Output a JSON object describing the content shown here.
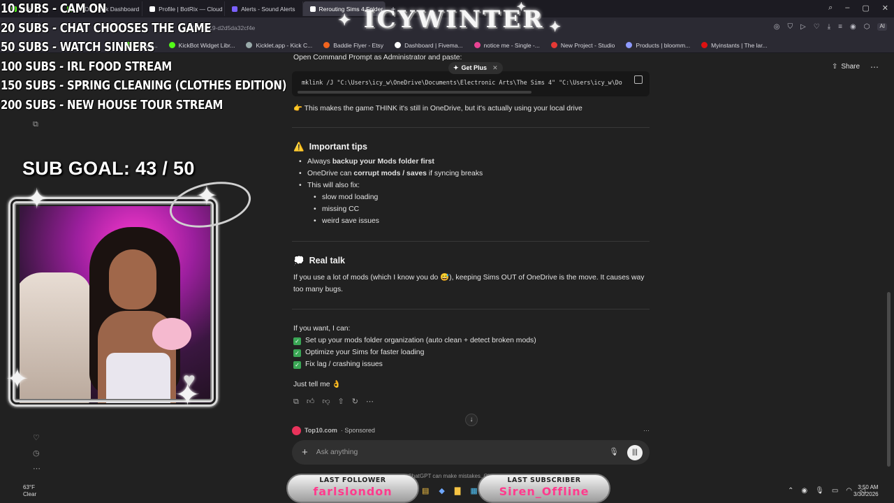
{
  "browser": {
    "tabs": [
      {
        "label": "Kick",
        "color": "#53fc18"
      },
      {
        "label": "VODs - Kick Dashboard",
        "color": "#53fc18"
      },
      {
        "label": "Profile | BotRix — Cloud S",
        "color": "#ffffff"
      },
      {
        "label": "Alerts - Sound Alerts",
        "color": "#7b61ff"
      },
      {
        "label": "Rerouting Sims 4 Folder",
        "color": "#ffffff"
      }
    ],
    "url": "328-bf19-d2d5da32cf4e",
    "ai_label": "AI",
    "bookmarks": [
      {
        "label": "Bot an...",
        "color": "#53fc18"
      },
      {
        "label": "KickBot Widget Libr...",
        "color": "#53fc18"
      },
      {
        "label": "Kicklet.app - Kick C...",
        "color": "#9aa"
      },
      {
        "label": "Baddie Flyer - Etsy",
        "color": "#f1641e"
      },
      {
        "label": "Dashboard | Fivema...",
        "color": "#ffffff"
      },
      {
        "label": "notice me - Single -...",
        "color": "#e84393"
      },
      {
        "label": "New Project - Studio",
        "color": "#e53935"
      },
      {
        "label": "Products | bloomm...",
        "color": "#8e9aff"
      },
      {
        "label": "Myinstants | The lar...",
        "color": "#d11"
      }
    ]
  },
  "overlay": {
    "goals": [
      "10 SUBS - CAM ON",
      "20 SUBS - CHAT CHOOSES THE GAME",
      "50 SUBS - WATCH SINNERS",
      "100 SUBS - IRL FOOD STREAM",
      "150 SUBS - SPRING CLEANING (CLOTHES EDITION)",
      "200 SUBS - NEW HOUSE TOUR STREAM"
    ],
    "brand": "ICYWINTER",
    "sub_goal": "SUB GOAL: 43 / 50",
    "sub_goal_current": 43,
    "sub_goal_target": 50,
    "last_follower_label": "LAST FOLLOWER",
    "last_follower": "farlslondon",
    "last_subscriber_label": "LAST SUBSCRIBER",
    "last_subscriber": "Siren_Offline"
  },
  "chat": {
    "intro": "Open Command Prompt as Administrator and paste:",
    "get_plus": "Get Plus",
    "code": "mklink /J \"C:\\Users\\icy_w\\OneDrive\\Documents\\Electronic Arts\\The Sims 4\" \"C:\\Users\\icy_w\\Do",
    "note": "This makes the game THINK it's still in OneDrive, but it's actually using your local drive",
    "tips_title": "Important tips",
    "tips": {
      "t1_pre": "Always ",
      "t1_bold": "backup your Mods folder first",
      "t2_pre": "OneDrive can ",
      "t2_bold": "corrupt mods / saves",
      "t2_post": " if syncing breaks",
      "t3": "This will also fix:",
      "sub": [
        "slow mod loading",
        "missing CC",
        "weird save issues"
      ]
    },
    "real_title": "Real talk",
    "real_text": "If you use a lot of mods (which I know you do 😅), keeping Sims OUT of OneDrive is the move. It causes way too many bugs.",
    "offer": "If you want, I can:",
    "checks": [
      "Set up your mods folder organization (auto clean + detect broken mods)",
      "Optimize your Sims for faster loading",
      "Fix lag / crashing issues"
    ],
    "closing": "Just tell me 👌",
    "sponsor_name": "Top10.com",
    "sponsor_tag": "· Sponsored",
    "ask_placeholder": "Ask anything",
    "disclaimer": "ChatGPT can make mistakes. Check important info.",
    "share": "Share"
  },
  "taskbar": {
    "temp": "63°F",
    "weather": "Clear",
    "time": "3:50 AM",
    "date": "3/30/2026"
  }
}
